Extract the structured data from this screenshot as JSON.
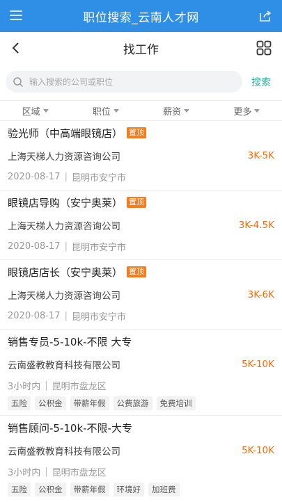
{
  "app": {
    "title": "职位搜索_云南人才网"
  },
  "nav": {
    "title": "找工作"
  },
  "search": {
    "placeholder": "输入搜索的公司或职位",
    "button_label": "搜索"
  },
  "filters": [
    {
      "label": "区域"
    },
    {
      "label": "职位"
    },
    {
      "label": "薪资"
    },
    {
      "label": "更多"
    }
  ],
  "jobs": [
    {
      "title": "验光师（中高端眼镜店）",
      "badge": "置顶",
      "company": "上海天梯人力资源咨询公司",
      "salary": "3K-5K",
      "date": "2020-08-17",
      "location": "昆明市安宁市",
      "tags": []
    },
    {
      "title": "眼镜店导购（安宁奥莱）",
      "badge": "置顶",
      "company": "上海天梯人力资源咨询公司",
      "salary": "3K-4.5K",
      "date": "2020-08-17",
      "location": "昆明市安宁市",
      "tags": []
    },
    {
      "title": "眼镜店店长（安宁奥莱）",
      "badge": "置顶",
      "company": "上海天梯人力资源咨询公司",
      "salary": "3K-6K",
      "date": "2020-08-17",
      "location": "昆明市安宁市",
      "tags": []
    },
    {
      "title": "销售专员-5-10k-不限 大专",
      "badge": "",
      "company": "云南盛教教育科技有限公司",
      "salary": "5K-10K",
      "date": "3小时内",
      "location": "昆明市盘龙区",
      "tags": [
        "五险",
        "公积金",
        "带薪年假",
        "公费旅游",
        "免费培训"
      ]
    },
    {
      "title": "销售顾问-5-10k-不限-大专",
      "badge": "",
      "company": "云南盛教教育科技有限公司",
      "salary": "5K-10K",
      "date": "3小时内",
      "location": "昆明市盘龙区",
      "tags": [
        "五险",
        "公积金",
        "带薪年假",
        "环境好",
        "加班费"
      ]
    }
  ],
  "colors": {
    "brand": "#2f8ee6",
    "salary": "#f56b0c",
    "badge": "#f57c1f",
    "search_button": "#2bb3a1"
  }
}
